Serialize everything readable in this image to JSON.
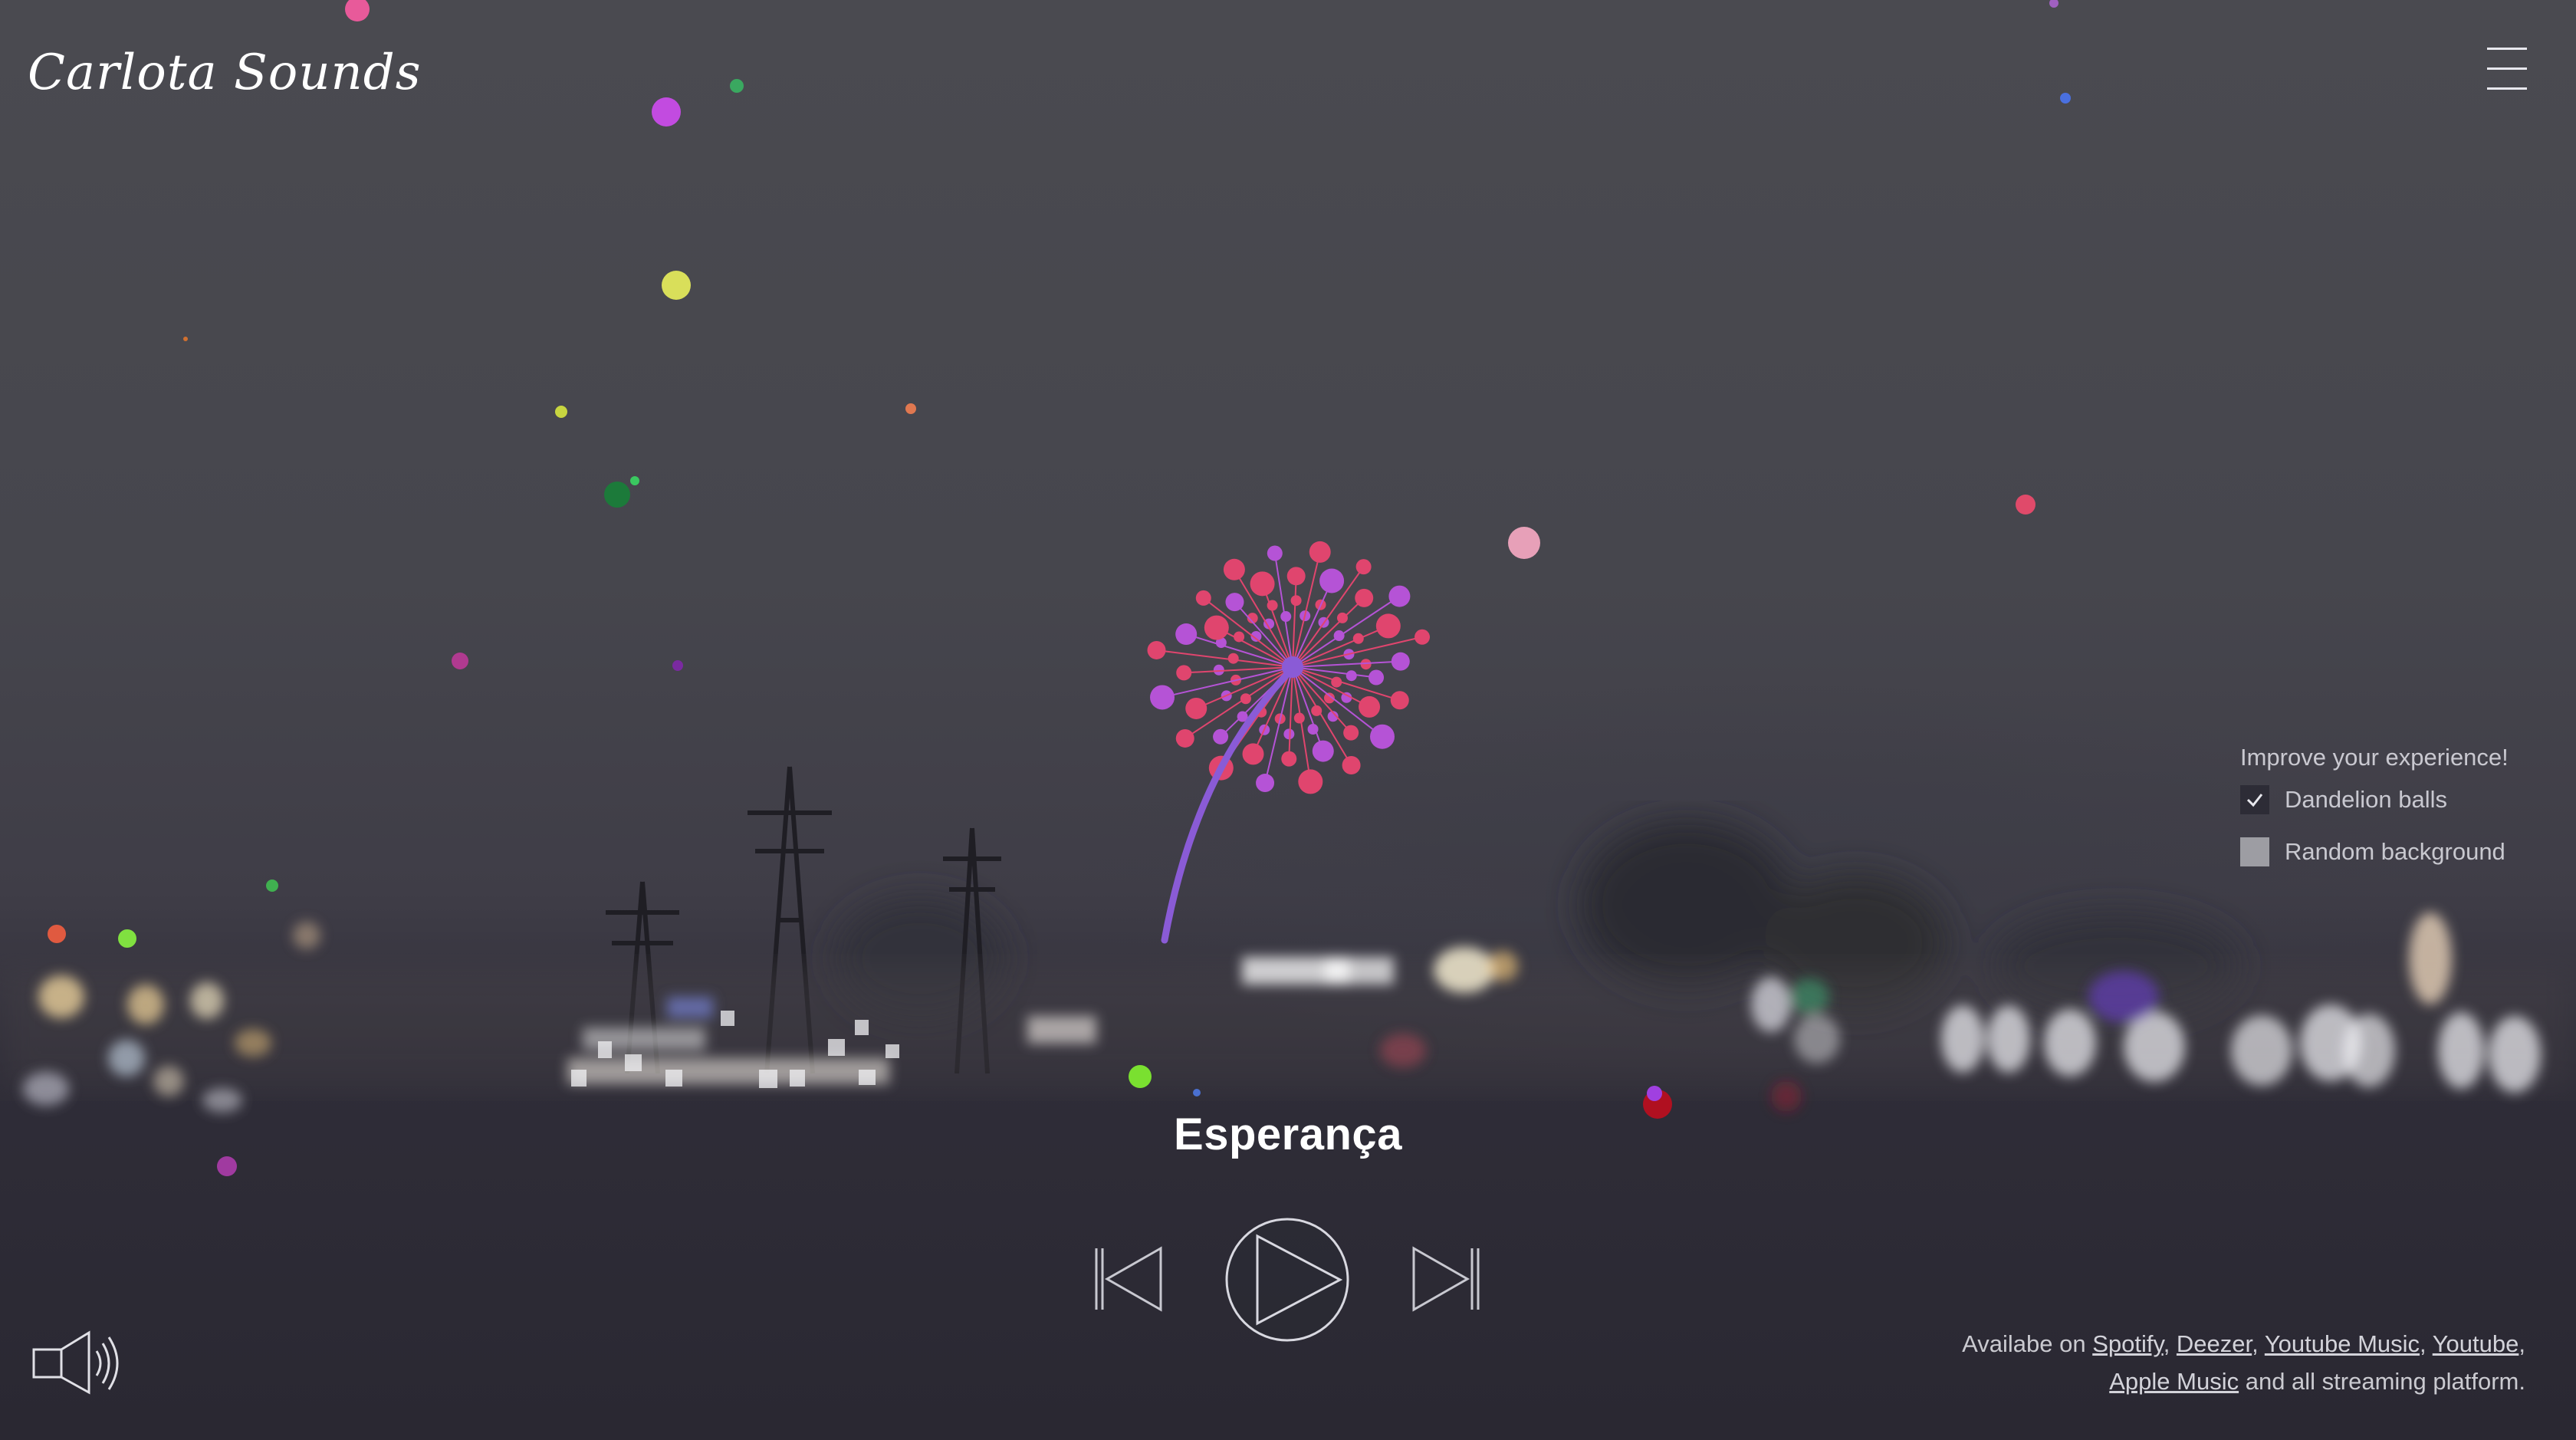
{
  "app": {
    "brand": "Carlota Sounds"
  },
  "player": {
    "song_title": "Esperança"
  },
  "experience": {
    "title": "Improve your experience!",
    "options": [
      {
        "label": "Dandelion balls",
        "checked": true
      },
      {
        "label": "Random background",
        "checked": false
      }
    ]
  },
  "footer": {
    "prefix": "Availabe on",
    "platforms": [
      "Spotify",
      "Deezer",
      "Youtube Music",
      "Youtube",
      "Apple Music"
    ],
    "suffix": "and all streaming platform."
  },
  "icons": {
    "menu": "hamburger-menu-icon",
    "prev": "skip-previous-icon",
    "play": "play-icon",
    "next": "skip-next-icon",
    "sound": "speaker-volume-icon",
    "check": "checkmark-icon"
  },
  "colors": {
    "dandelion_stem": "#8a5bd6",
    "dandelion_pink": "#e0456e",
    "dandelion_purple": "#b553d6",
    "text": "#ffffff"
  }
}
